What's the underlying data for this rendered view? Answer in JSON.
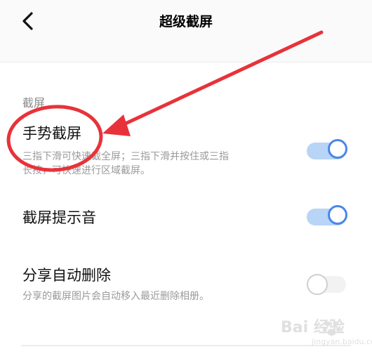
{
  "header": {
    "title": "超级截屏",
    "back_icon": "chevron-left-icon"
  },
  "section": {
    "label": "截屏"
  },
  "rows": [
    {
      "title": "手势截屏",
      "description_line1": "三指下滑可快速截全屏；三指下滑并按住或三指",
      "description_line2": "长按，可快速进行区域截屏。",
      "toggle_state": "on"
    },
    {
      "title": "截屏提示音",
      "toggle_state": "on"
    },
    {
      "title": "分享自动删除",
      "description": "分享的截屏图片会自动移入最近删除相册。",
      "toggle_state": "off"
    }
  ],
  "watermark": {
    "text": "Bai 经验",
    "sub": "jingyan.baidu.com"
  },
  "colors": {
    "accent": "#4a86e8",
    "annotation_red": "#e8323a",
    "secondary_text": "#9a9a9a"
  }
}
